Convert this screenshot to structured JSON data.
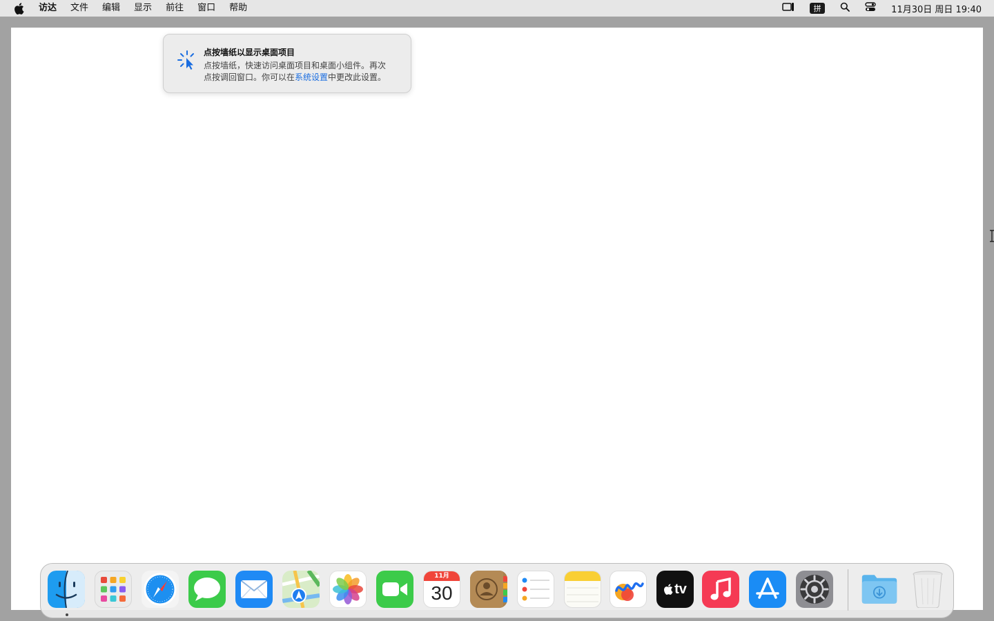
{
  "menubar": {
    "items": [
      "访达",
      "文件",
      "编辑",
      "显示",
      "前往",
      "窗口",
      "帮助"
    ],
    "ime_label": "拼",
    "clock": "11月30日 周日 19:40"
  },
  "tip": {
    "title": "点按墙纸以显示桌面项目",
    "body_line1": "点按墙纸，快速访问桌面项目和桌面小组件。再次",
    "body_line2_prefix": "点按调回窗口。你可以在",
    "body_link": "系统设置",
    "body_line2_suffix": "中更改此设置。"
  },
  "dock": {
    "apps": [
      {
        "icon": "finder-icon"
      },
      {
        "icon": "launchpad-icon"
      },
      {
        "icon": "safari-icon"
      },
      {
        "icon": "messages-icon"
      },
      {
        "icon": "mail-icon"
      },
      {
        "icon": "maps-icon"
      },
      {
        "icon": "photos-icon"
      },
      {
        "icon": "facetime-icon"
      },
      {
        "icon": "calendar-icon"
      },
      {
        "icon": "contacts-icon"
      },
      {
        "icon": "reminders-icon"
      },
      {
        "icon": "notes-icon"
      },
      {
        "icon": "freeform-icon"
      },
      {
        "icon": "appletv-icon"
      },
      {
        "icon": "music-icon"
      },
      {
        "icon": "appstore-icon"
      },
      {
        "icon": "system-settings-icon"
      },
      {
        "icon": "downloads-folder-icon"
      },
      {
        "icon": "trash-icon"
      }
    ],
    "calendar_month": "11月",
    "calendar_day": "30",
    "tv_label": "tv"
  },
  "colors": {
    "accent": "#1a6de0",
    "desktop": "#a2a2a2",
    "menubar": "#e6e6e6"
  }
}
